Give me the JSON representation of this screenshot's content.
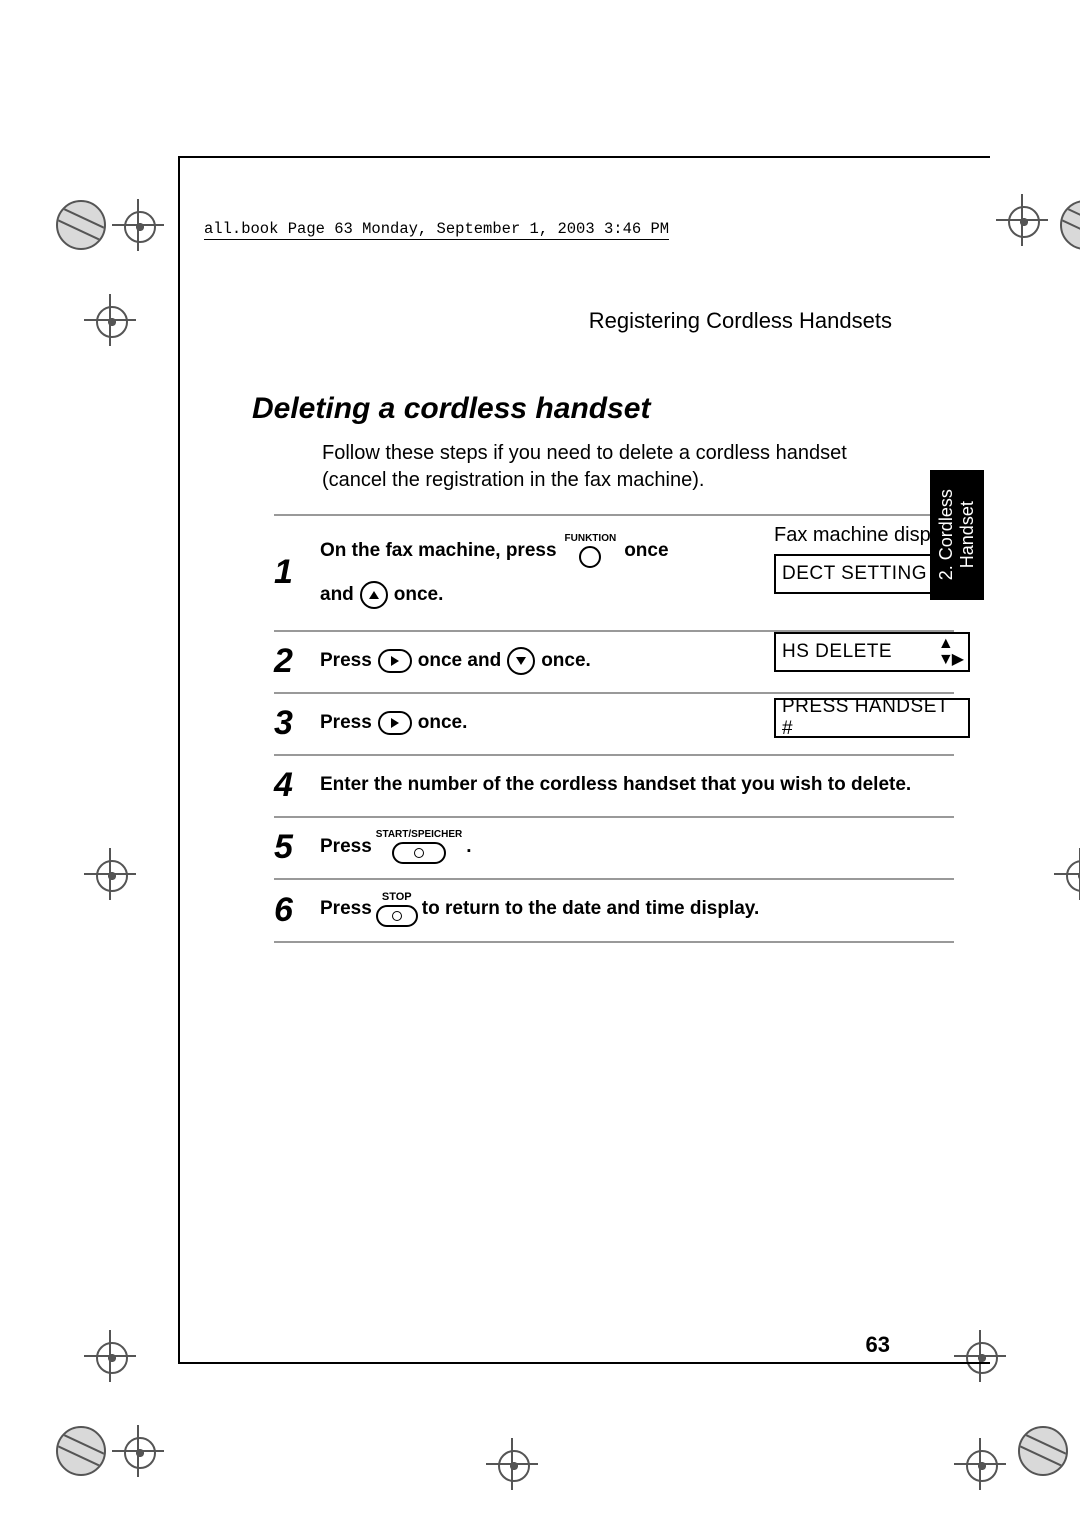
{
  "book_info": "all.book  Page 63  Monday, September 1, 2003  3:46 PM",
  "running_head": "Registering Cordless Handsets",
  "section_title": "Deleting a cordless handset",
  "intro": "Follow these steps if you need to delete a cordless handset (cancel the registration in the fax machine).",
  "display_label": "Fax machine display:",
  "displays": {
    "d1": "DECT SETTING",
    "d2": "HS DELETE",
    "d3": "PRESS HANDSET #"
  },
  "keys": {
    "funktion": "FUNKTION",
    "start_speicher": "START/SPEICHER",
    "stop": "STOP"
  },
  "steps": {
    "s1_num": "1",
    "s1_a": "On the fax machine, press",
    "s1_b": "once",
    "s1_c": "and",
    "s1_d": "once.",
    "s2_num": "2",
    "s2_a": "Press",
    "s2_b": "once and",
    "s2_c": "once.",
    "s3_num": "3",
    "s3_a": "Press",
    "s3_b": "once.",
    "s4_num": "4",
    "s4_a": "Enter the number of the cordless handset that you wish to delete.",
    "s5_num": "5",
    "s5_a": "Press",
    "s5_b": ".",
    "s6_num": "6",
    "s6_a": "Press",
    "s6_b": "to return to the date and time display."
  },
  "page_number": "63",
  "side_tab": "2. Cordless\nHandset",
  "arrows_icon": "▲▼▶"
}
